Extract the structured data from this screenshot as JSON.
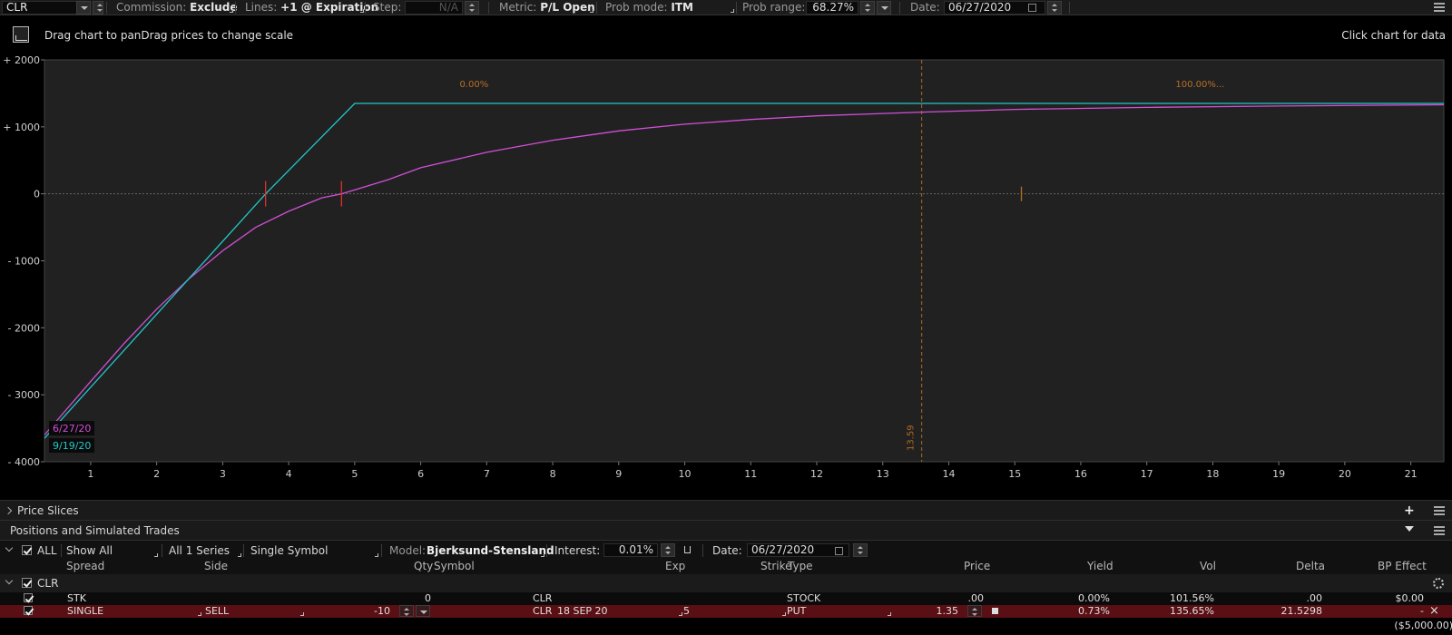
{
  "toolbar": {
    "symbol": "CLR",
    "commission_label": "Commission:",
    "commission_value": "Exclude",
    "lines_label": "Lines:",
    "lines_value": "+1 @ Expiration",
    "step_label": "Step:",
    "step_value": "N/A",
    "metric_label": "Metric:",
    "metric_value": "P/L Open",
    "prob_mode_label": "Prob mode:",
    "prob_mode_value": "ITM",
    "prob_range_label": "Prob range:",
    "prob_range_value": "68.27%",
    "date_label": "Date:",
    "date_value": "06/27/2020"
  },
  "hints": {
    "left": "Drag chart to panDrag prices to change scale",
    "right": "Click chart for data"
  },
  "chart_data": {
    "type": "line",
    "xlim": [
      0.3,
      21.5
    ],
    "ylim": [
      -4000,
      2000
    ],
    "x_ticks": [
      1,
      2,
      3,
      4,
      5,
      6,
      7,
      8,
      9,
      10,
      11,
      12,
      13,
      14,
      15,
      16,
      17,
      18,
      19,
      20,
      21
    ],
    "y_ticks": [
      {
        "value": 2000,
        "label": "+ 2000"
      },
      {
        "value": 1000,
        "label": "+ 1000"
      },
      {
        "value": 0,
        "label": "0"
      },
      {
        "value": -1000,
        "label": "- 1000"
      },
      {
        "value": -2000,
        "label": "- 2000"
      },
      {
        "value": -3000,
        "label": "- 3000"
      },
      {
        "value": -4000,
        "label": "- 4000"
      }
    ],
    "grid": false,
    "zero_line": true,
    "prob_labels": {
      "left": "0.00%",
      "right": "100.00%..."
    },
    "current_price": {
      "value": 13.59,
      "label": "13.59"
    },
    "series": [
      {
        "name": "6/27/20",
        "color": "#d24fd8",
        "x": [
          0.3,
          1.0,
          1.5,
          2.0,
          2.5,
          3.0,
          3.5,
          4.0,
          4.5,
          4.8,
          5.5,
          6.0,
          7.0,
          8.0,
          9.0,
          10.0,
          11.0,
          12.0,
          13.0,
          13.59,
          15.0,
          17.0,
          19.0,
          21.5
        ],
        "y": [
          -3600,
          -2800,
          -2240,
          -1720,
          -1260,
          -850,
          -500,
          -260,
          -60,
          0,
          210,
          390,
          620,
          800,
          940,
          1040,
          1110,
          1165,
          1200,
          1220,
          1260,
          1290,
          1310,
          1330
        ]
      },
      {
        "name": "9/19/20",
        "color": "#22c8c8",
        "x": [
          0.3,
          3.65,
          5.0,
          21.5
        ],
        "y": [
          -3650,
          0,
          1350,
          1350
        ]
      }
    ],
    "breakeven_markers": [
      {
        "x": 3.65,
        "color": "#e03030"
      },
      {
        "x": 4.8,
        "color": "#e03030"
      },
      {
        "x": 15.1,
        "color": "#b07020"
      }
    ]
  },
  "panels": {
    "price_slices": "Price Slices",
    "positions_title": "Positions and Simulated Trades"
  },
  "controls": {
    "all_label": "ALL",
    "show_all": "Show All",
    "series": "All 1 Series",
    "symbol_mode": "Single Symbol",
    "model_label": "Model:",
    "model_value": "Bjerksund-Stensland",
    "interest_label": "Interest:",
    "interest_value": "0.01%",
    "date_label": "Date:",
    "date_value": "06/27/2020"
  },
  "table": {
    "headers": [
      "Spread",
      "Side",
      "Qty",
      "Symbol",
      "Exp",
      "Strike",
      "Type",
      "Price",
      "Yield",
      "Vol",
      "Delta",
      "BP Effect"
    ],
    "group": "CLR",
    "rows": [
      {
        "spread": "STK",
        "side": "",
        "qty": "0",
        "symbol": "CLR",
        "exp": "",
        "strike": "",
        "type": "STOCK",
        "price": ".00",
        "yield": "0.00%",
        "vol": "101.56%",
        "delta": ".00",
        "bp": "$0.00"
      },
      {
        "spread": "SINGLE",
        "side": "SELL",
        "qty": "-10",
        "symbol": "CLR",
        "exp": "18 SEP 20",
        "strike": "5",
        "type": "PUT",
        "price": "1.35",
        "yield": "0.73%",
        "vol": "135.65%",
        "delta": "21.5298",
        "bp": "-"
      }
    ],
    "total_bp": "($5,000.00)"
  }
}
